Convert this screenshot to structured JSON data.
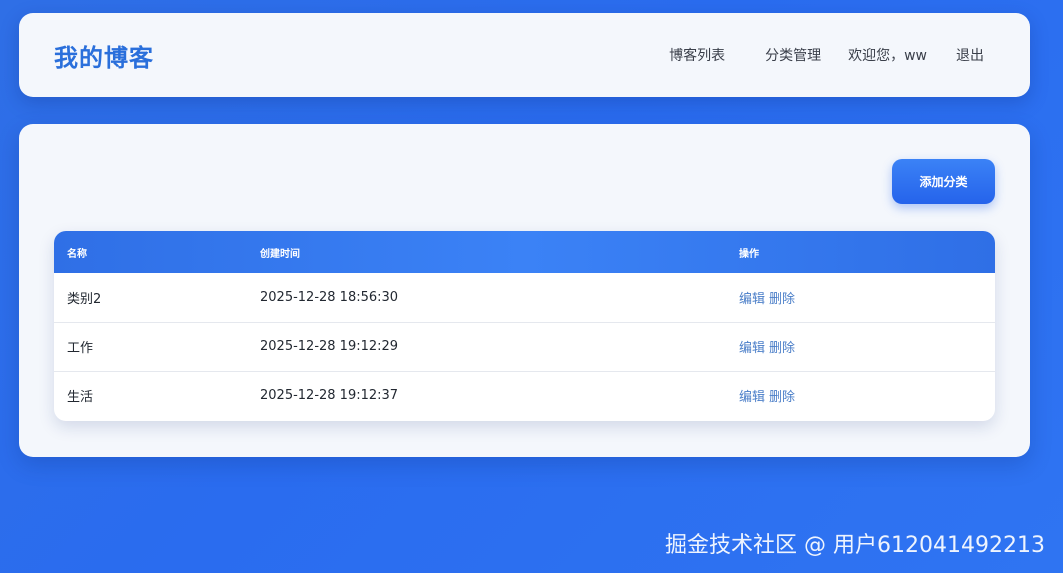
{
  "header": {
    "brand": "我的博客",
    "nav": {
      "blog_list": "博客列表",
      "category_manage": "分类管理",
      "welcome": "欢迎您，ww",
      "logout": "退出"
    }
  },
  "toolbar": {
    "add_category_label": "添加分类"
  },
  "table": {
    "columns": {
      "name": "名称",
      "created": "创建时间",
      "actions": "操作"
    },
    "rows": [
      {
        "name": "类别2",
        "created": "2025-12-28 18:56:30",
        "edit": "编辑",
        "delete": "删除"
      },
      {
        "name": "工作",
        "created": "2025-12-28 19:12:29",
        "edit": "编辑",
        "delete": "删除"
      },
      {
        "name": "生活",
        "created": "2025-12-28 19:12:37",
        "edit": "编辑",
        "delete": "删除"
      }
    ]
  },
  "watermark": "掘金技术社区 @ 用户612041492213",
  "colors": {
    "accent": "#2a6fdb",
    "primary_button": "#2563eb",
    "link": "#4a7ec8"
  }
}
